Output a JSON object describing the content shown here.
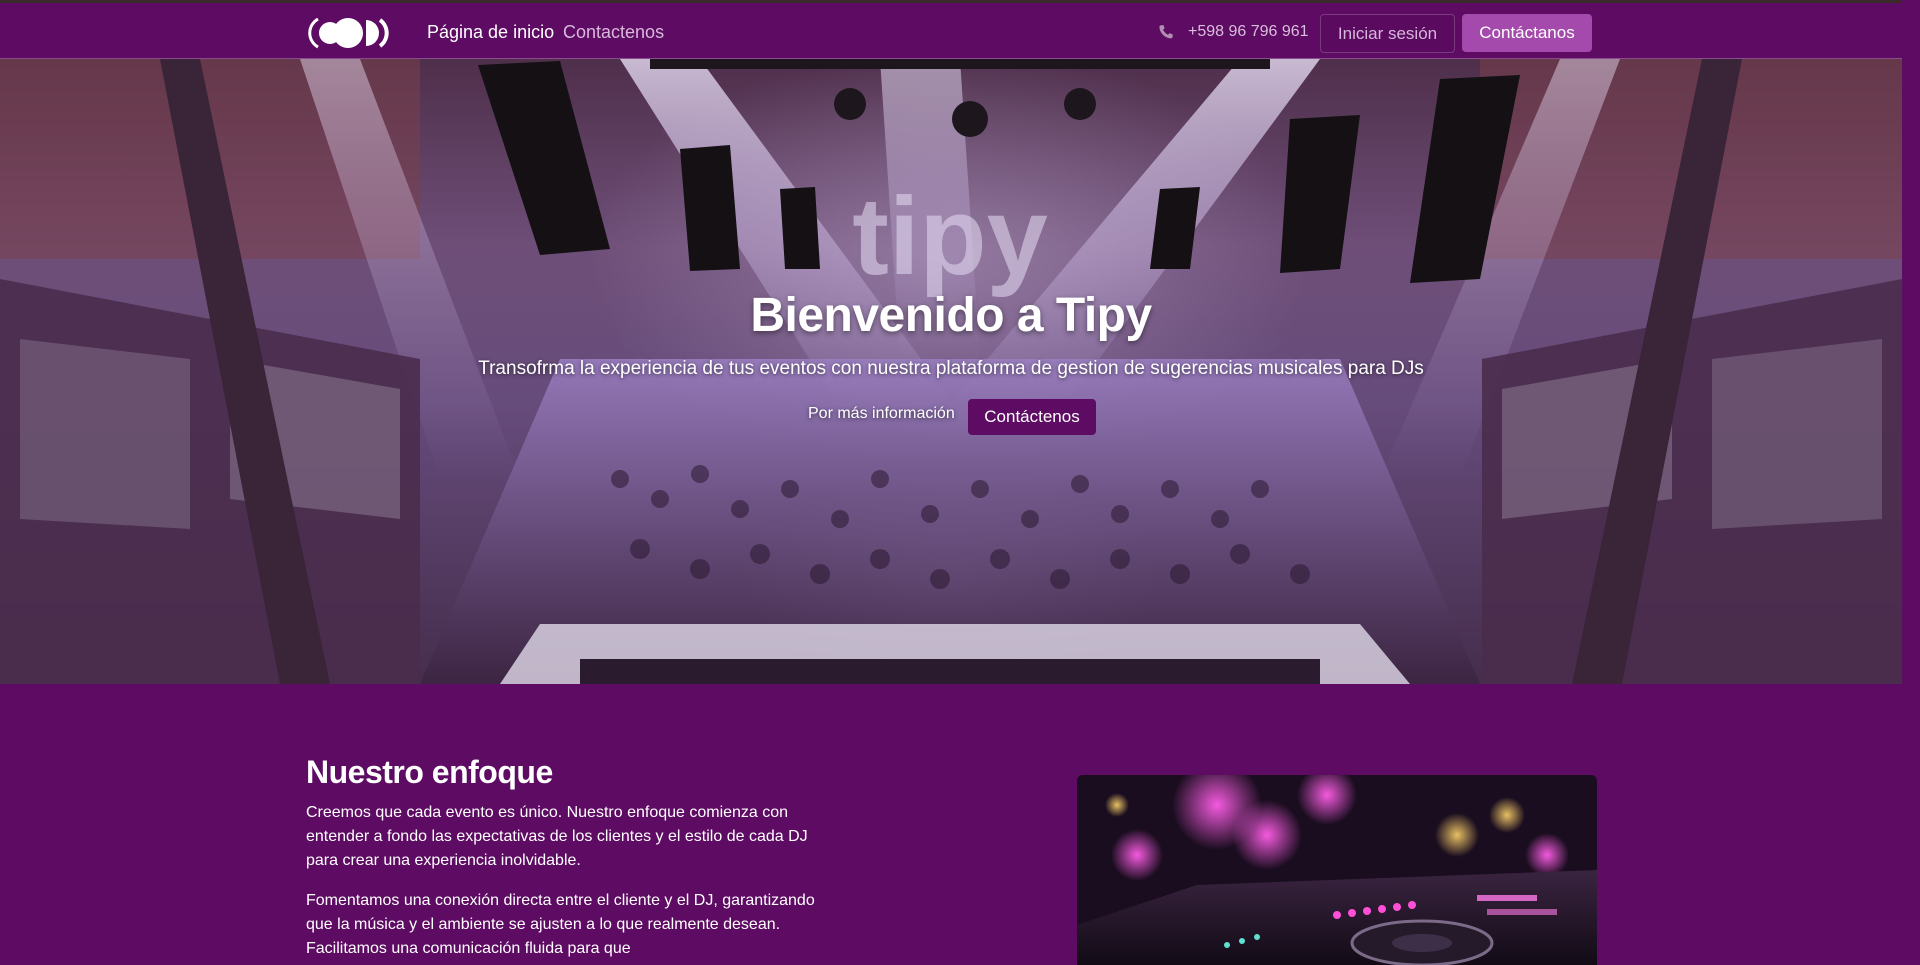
{
  "navbar": {
    "logo_icon": "tipy-logo-icon",
    "links": [
      {
        "label": "Página de inicio",
        "active": true
      },
      {
        "label": "Contactenos",
        "active": false
      }
    ],
    "phone_icon": "phone-icon",
    "phone": "+598 96 796 961",
    "login_label": "Iniciar sesión",
    "contact_label": "Contáctanos"
  },
  "hero": {
    "title": "Bienvenido a Tipy",
    "subtitle": "Transofrma la experiencia de tus eventos con nuestra plataforma de gestion de sugerencias musicales para DJs",
    "more_info": "Por más información",
    "cta_label": "Contáctenos",
    "stage_sign": "tipy"
  },
  "focus": {
    "title": "Nuestro enfoque",
    "paragraph1": "Creemos que cada evento es único. Nuestro enfoque comienza con entender a fondo las expectativas de los clientes y el estilo de cada DJ para crear una experiencia inolvidable.",
    "paragraph2": "Fomentamos una conexión directa entre el cliente y el DJ, garantizando que la música y el ambiente se ajusten a lo que realmente desean. Facilitamos una comunicación fluida para que"
  },
  "colors": {
    "brand_purple": "#5e0b63",
    "accent_purple": "#a54aad",
    "text_light": "#ffffff"
  }
}
